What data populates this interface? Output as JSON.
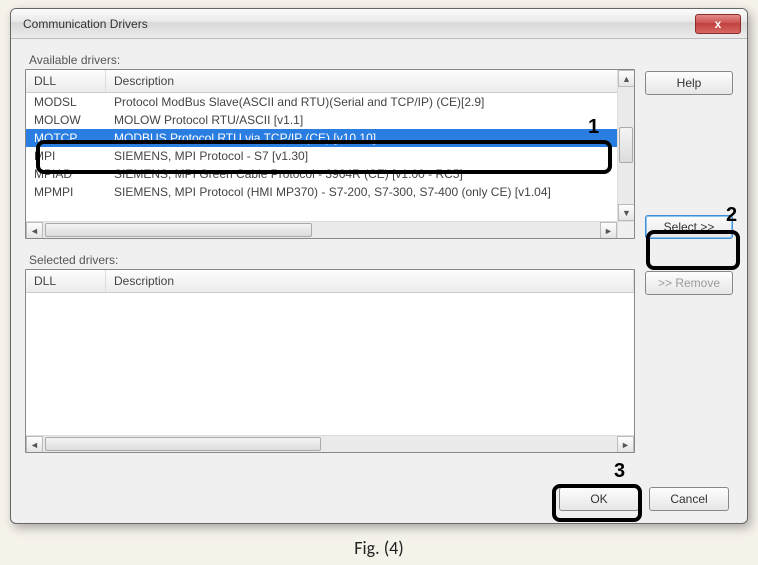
{
  "dialog": {
    "title": "Communication Drivers",
    "available_label": "Available drivers:",
    "selected_label": "Selected drivers:",
    "columns": {
      "dll": "DLL",
      "description": "Description"
    },
    "buttons": {
      "help": "Help",
      "select": "Select >>",
      "remove": ">> Remove",
      "ok": "OK",
      "cancel": "Cancel",
      "close_glyph": "x"
    }
  },
  "available": [
    {
      "dll": "MODSL",
      "description": "Protocol ModBus Slave(ASCII and RTU)(Serial and TCP/IP) (CE)[2.9]",
      "selected": false
    },
    {
      "dll": "MOLOW",
      "description": "MOLOW Protocol RTU/ASCII [v1.1]",
      "selected": false
    },
    {
      "dll": "MOTCP",
      "description": "MODBUS Protocol RTU via TCP/IP (CE) [v10.10]",
      "selected": true
    },
    {
      "dll": "MPI",
      "description": "SIEMENS, MPI Protocol - S7 [v1.30]",
      "selected": false
    },
    {
      "dll": "MPIAD",
      "description": "SIEMENS, MPI Green Cable Protocol - 3964R (CE) [v1.00 - RC5]",
      "selected": false
    },
    {
      "dll": "MPMPI",
      "description": "SIEMENS, MPI Protocol (HMI MP370) - S7-200, S7-300, S7-400 (only CE) [v1.04]",
      "selected": false
    }
  ],
  "selected": [],
  "annotations": {
    "one": "1",
    "two": "2",
    "three": "3"
  },
  "figure_caption": "Fig. (4)"
}
